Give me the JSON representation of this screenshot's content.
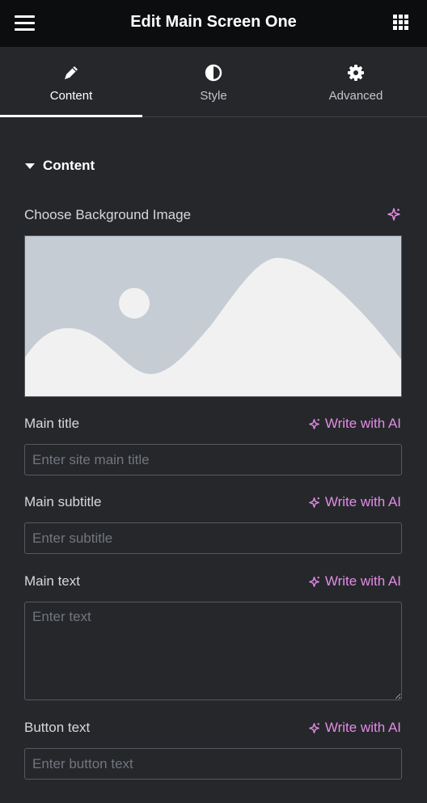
{
  "header": {
    "title": "Edit Main Screen One",
    "menu_icon": "hamburger-icon",
    "apps_icon": "grid-icon"
  },
  "tabs": [
    {
      "label": "Content",
      "icon": "pencil-icon",
      "active": true
    },
    {
      "label": "Style",
      "icon": "contrast-icon",
      "active": false
    },
    {
      "label": "Advanced",
      "icon": "gear-icon",
      "active": false
    }
  ],
  "section": {
    "title": "Content"
  },
  "background": {
    "label": "Choose Background Image",
    "ai_icon": "sparkle-icon"
  },
  "fields": {
    "main_title": {
      "label": "Main title",
      "ai_label": "Write with AI",
      "placeholder": "Enter site main title",
      "value": ""
    },
    "main_subtitle": {
      "label": "Main subtitle",
      "ai_label": "Write with AI",
      "placeholder": "Enter subtitle",
      "value": ""
    },
    "main_text": {
      "label": "Main text",
      "ai_label": "Write with AI",
      "placeholder": "Enter text",
      "value": ""
    },
    "button_text": {
      "label": "Button text",
      "ai_label": "Write with AI",
      "placeholder": "Enter button text",
      "value": ""
    }
  },
  "colors": {
    "accent_ai": "#e28ce6",
    "panel_bg": "#26272b",
    "header_bg": "#0c0d0e",
    "placeholder_img": "#c5ccd3"
  }
}
